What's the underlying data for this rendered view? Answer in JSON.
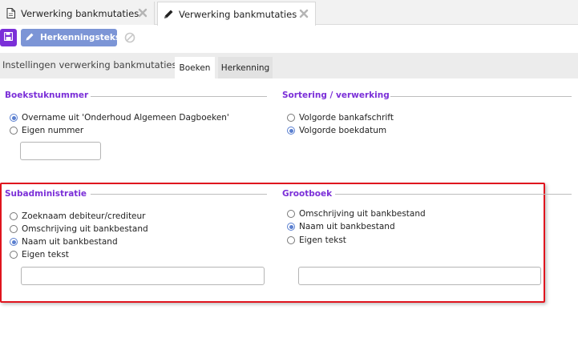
{
  "doc_tabs": [
    {
      "label": "Verwerking bankmutaties",
      "icon": "document-icon",
      "active": false
    },
    {
      "label": "Verwerking bankmutaties",
      "icon": "pencil-icon",
      "active": true
    }
  ],
  "toolbar": {
    "save_icon": "save-icon",
    "herkenning_label": "Herkenningsteksten",
    "cancel_icon": "cancel-icon"
  },
  "settings": {
    "title": "Instellingen verwerking bankmutaties",
    "tabs": [
      {
        "label": "Boeken",
        "active": true
      },
      {
        "label": "Herkenning",
        "active": false
      }
    ]
  },
  "boekstuknummer": {
    "title": "Boekstuknummer",
    "options": [
      {
        "label": "Overname uit 'Onderhoud Algemeen Dagboeken'",
        "selected": true
      },
      {
        "label": "Eigen nummer",
        "selected": false
      }
    ],
    "input_value": ""
  },
  "sortering": {
    "title": "Sortering / verwerking",
    "options": [
      {
        "label": "Volgorde bankafschrift",
        "selected": false
      },
      {
        "label": "Volgorde boekdatum",
        "selected": true
      }
    ]
  },
  "subadministratie": {
    "title": "Subadministratie",
    "options": [
      {
        "label": "Zoeknaam debiteur/crediteur",
        "selected": false
      },
      {
        "label": "Omschrijving uit bankbestand",
        "selected": false
      },
      {
        "label": "Naam uit bankbestand",
        "selected": true
      },
      {
        "label": "Eigen tekst",
        "selected": false
      }
    ],
    "input_value": ""
  },
  "grootboek": {
    "title": "Grootboek",
    "options": [
      {
        "label": "Omschrijving uit bankbestand",
        "selected": false
      },
      {
        "label": "Naam uit bankbestand",
        "selected": true
      },
      {
        "label": "Eigen tekst",
        "selected": false
      }
    ],
    "input_value": ""
  },
  "colors": {
    "accent_purple": "#7b2fd8",
    "button_blue": "#7c95d6",
    "highlight_red": "#e0141e"
  }
}
